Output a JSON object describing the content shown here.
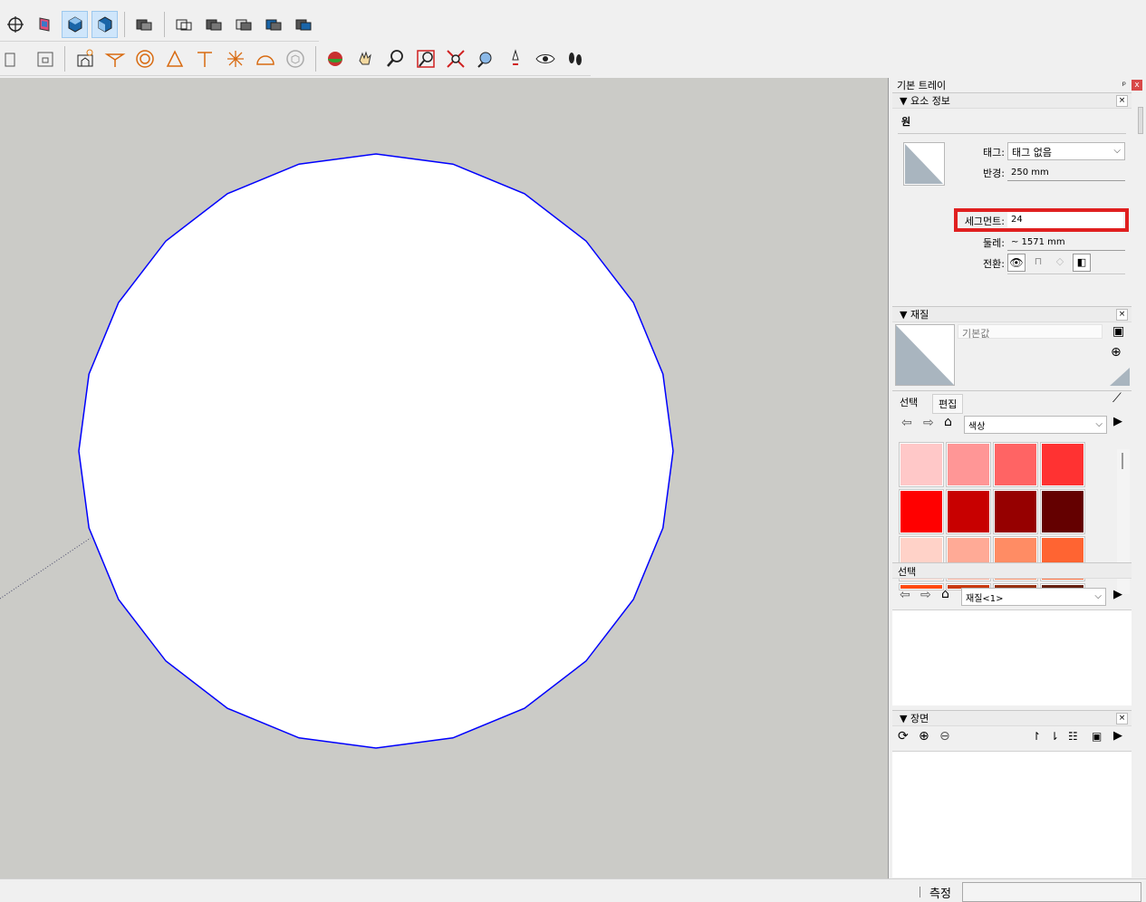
{
  "tray": {
    "title": "기본 트레이",
    "pin_glyph": "ᵖ",
    "close_glyph": "x"
  },
  "entity_info": {
    "header": "▼ 요소 정보",
    "entity_type": "원",
    "tag_label": "태그:",
    "tag_value": "태그 없음",
    "radius_label": "반경:",
    "radius_value": "250 mm",
    "segments_label": "세그먼트:",
    "segments_value": "24",
    "circumference_label": "둘레:",
    "circumference_value": "~ 1571 mm",
    "toggles_label": "전환:"
  },
  "materials": {
    "header": "▼ 재질",
    "material_name": "기본값",
    "tab_select": "선택",
    "tab_edit": "편집",
    "library_dropdown": "색상",
    "swatches": [
      "#ffc8c8",
      "#ff9696",
      "#ff6464",
      "#ff3232",
      "#ff0000",
      "#c80000",
      "#960000",
      "#640000",
      "#ffd2c8",
      "#ffaa96",
      "#ff8c64",
      "#ff6432"
    ],
    "select2_label": "선택",
    "select2_dropdown": "재질<1>"
  },
  "scenes": {
    "header": "▼ 장면"
  },
  "status": {
    "measure_label": "측정",
    "measure_value": ""
  },
  "colors": {
    "viewport_bg": "#cbcbc7",
    "circle_edge": "#0000ff",
    "highlight": "#e02020"
  }
}
